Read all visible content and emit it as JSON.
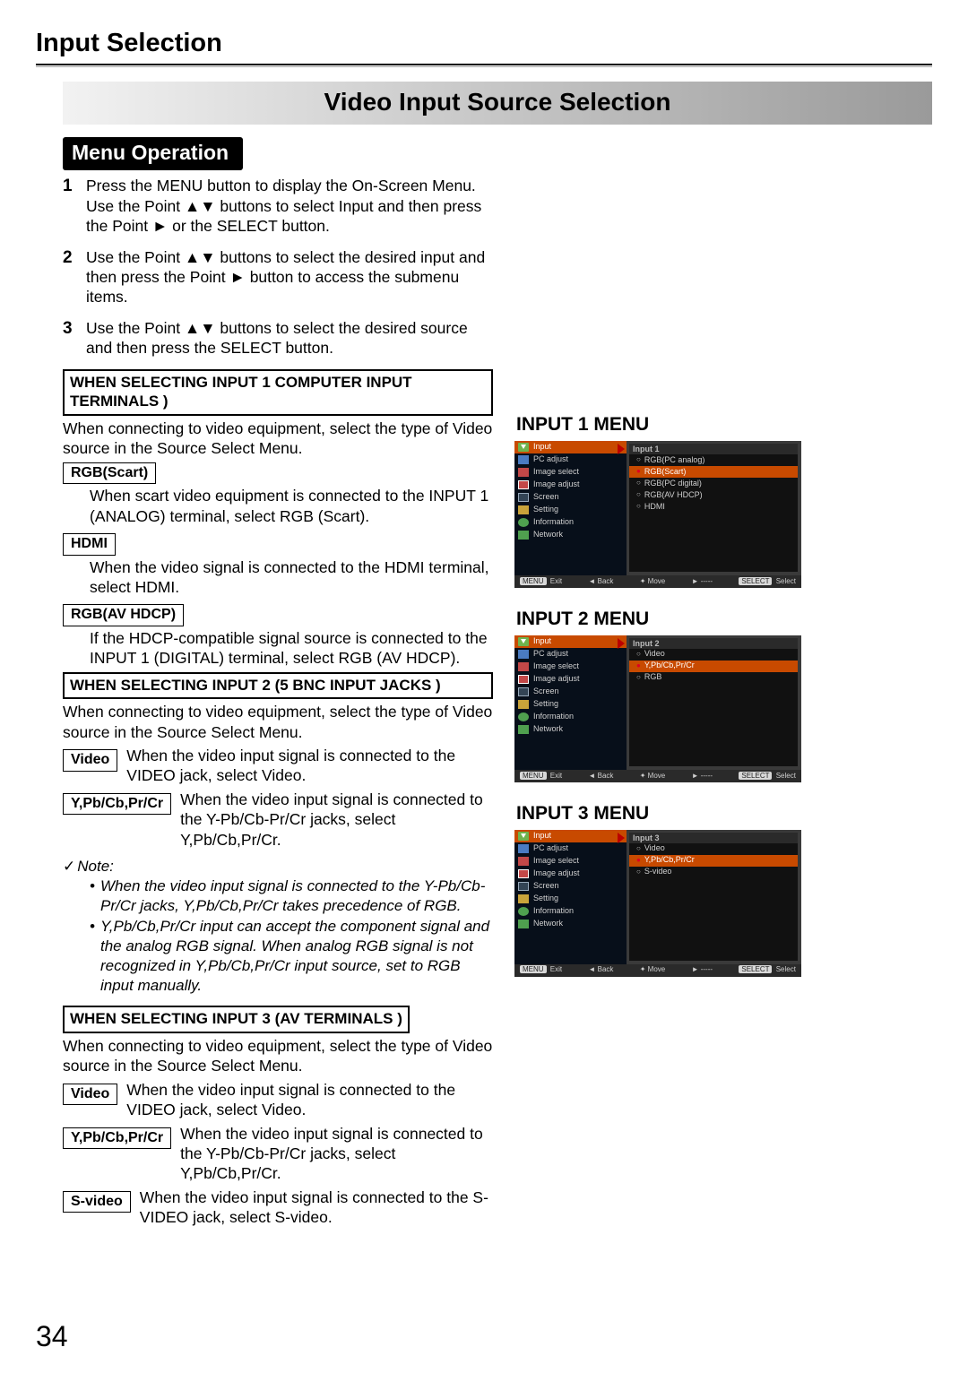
{
  "page_number": "34",
  "header": "Input Selection",
  "banner": "Video Input Source Selection",
  "menu_op_label": "Menu Operation",
  "steps": [
    {
      "n": "1",
      "t": "Press the MENU button to display the On-Screen Menu. Use the Point ▲▼ buttons to select Input and then press the Point ► or the SELECT button."
    },
    {
      "n": "2",
      "t": "Use the Point ▲▼ buttons to select the desired input and then press the Point ► button to access the submenu items."
    },
    {
      "n": "3",
      "t": "Use the Point ▲▼ buttons to select the desired source and then press the SELECT button."
    }
  ],
  "input1_box": "WHEN SELECTING INPUT 1 COMPUTER INPUT TERMINALS )",
  "input1_intro": "When connecting to video equipment, select the type of Video source in the Source Select Menu.",
  "rgb_scart_label": "RGB(Scart)",
  "rgb_scart_text": "When scart video equipment is connected to the INPUT 1 (ANALOG) terminal, select RGB (Scart).",
  "hdmi_label": "HDMI",
  "hdmi_text": "When the video signal is connected to the HDMI terminal, select HDMI.",
  "rgbav_label": "RGB(AV HDCP)",
  "rgbav_text": "If the HDCP-compatible signal source is connected to the INPUT 1 (DIGITAL) terminal, select RGB (AV HDCP).",
  "input2_box": "WHEN SELECTING INPUT 2 (5 BNC INPUT JACKS )",
  "input2_intro": "When connecting to video equipment, select the type of Video source in the Source Select Menu.",
  "video_label": "Video",
  "video_text2": "When the video input signal is connected to the VIDEO jack, select Video.",
  "ypbcb_label": "Y,Pb/Cb,Pr/Cr",
  "ypbcb_text2": "When the video input signal is connected to the Y-Pb/Cb-Pr/Cr jacks, select Y,Pb/Cb,Pr/Cr.",
  "note_label": "Note:",
  "notes": [
    "When the video input signal is connected to the Y-Pb/Cb-Pr/Cr jacks, Y,Pb/Cb,Pr/Cr takes precedence of RGB.",
    "Y,Pb/Cb,Pr/Cr input can accept the component signal and the analog RGB signal. When analog RGB signal is not recognized in Y,Pb/Cb,Pr/Cr input source, set to RGB input manually."
  ],
  "input3_box": "WHEN SELECTING INPUT 3 (AV TERMINALS )",
  "input3_intro": "When connecting to video equipment, select the type of Video source in the Source Select Menu.",
  "video_text3": "When the video input signal is connected to the VIDEO jack, select Video.",
  "ypbcb_text3": "When the video input signal is connected to the Y-Pb/Cb-Pr/Cr jacks, select Y,Pb/Cb,Pr/Cr.",
  "svideo_label": "S-video",
  "svideo_text": "When the video input signal is connected to the S-VIDEO jack, select S-video.",
  "right": {
    "sidebar": [
      "Input",
      "PC adjust",
      "Image select",
      "Image adjust",
      "Screen",
      "Setting",
      "Information",
      "Network"
    ],
    "nav": {
      "exit": "Exit",
      "back": "Back",
      "move": "Move",
      "dash": "-----",
      "select": "Select",
      "menu_tag": "MENU",
      "select_tag": "SELECT"
    },
    "menu1": {
      "title": "INPUT 1 MENU",
      "hdr": "Input 1",
      "opts": [
        "RGB(PC analog)",
        "RGB(Scart)",
        "RGB(PC digital)",
        "RGB(AV HDCP)",
        "HDMI"
      ],
      "sel": "RGB(Scart)"
    },
    "menu2": {
      "title": "INPUT 2 MENU",
      "hdr": "Input 2",
      "opts": [
        "Video",
        "Y,Pb/Cb,Pr/Cr",
        "RGB"
      ],
      "sel": "Y,Pb/Cb,Pr/Cr"
    },
    "menu3": {
      "title": "INPUT 3 MENU",
      "hdr": "Input 3",
      "opts": [
        "Video",
        "Y,Pb/Cb,Pr/Cr",
        "S-video"
      ],
      "sel": "Y,Pb/Cb,Pr/Cr"
    }
  }
}
